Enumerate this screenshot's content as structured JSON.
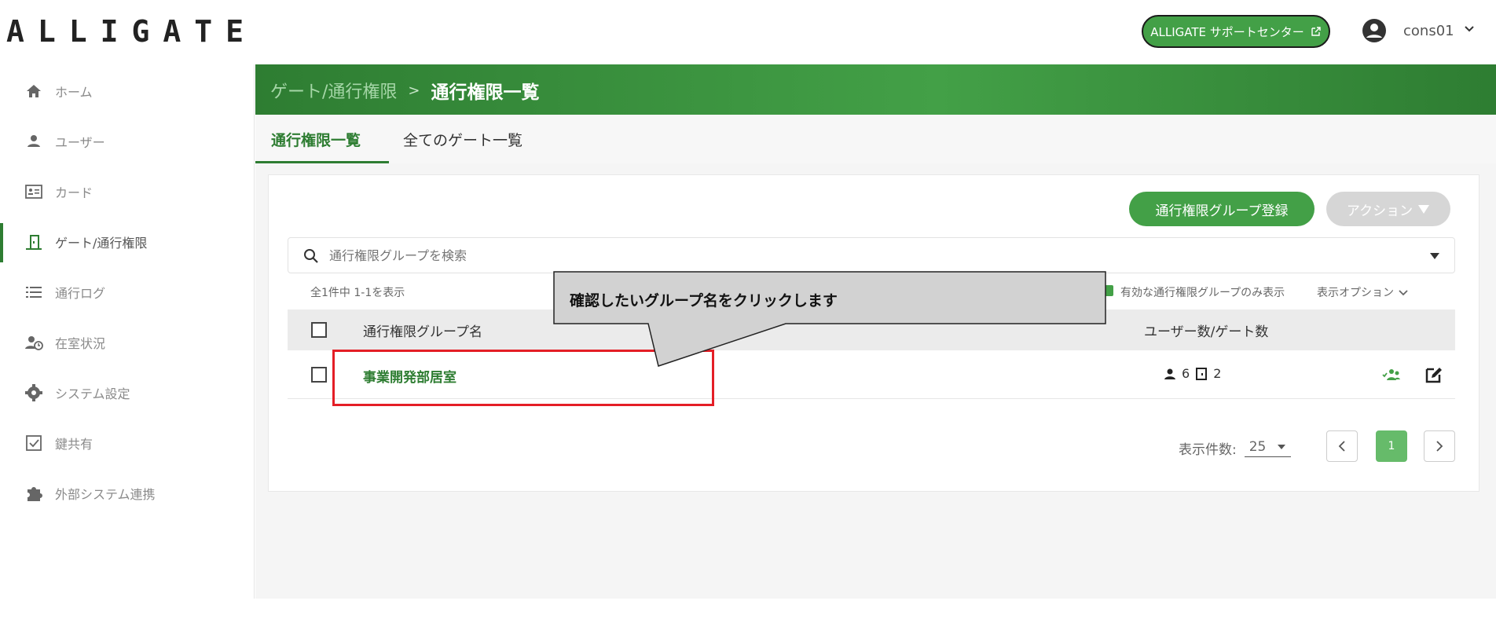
{
  "header": {
    "logo": "ALLIGATE",
    "support_button": "ALLIGATE サポートセンター",
    "user_name": "cons01"
  },
  "sidebar": {
    "items": [
      {
        "label": "ホーム",
        "icon": "home-icon"
      },
      {
        "label": "ユーザー",
        "icon": "user-icon"
      },
      {
        "label": "カード",
        "icon": "card-icon"
      },
      {
        "label": "ゲート/通行権限",
        "icon": "gate-icon",
        "active": true
      },
      {
        "label": "通行ログ",
        "icon": "list-icon"
      },
      {
        "label": "在室状況",
        "icon": "presence-icon"
      },
      {
        "label": "システム設定",
        "icon": "gear-icon"
      },
      {
        "label": "鍵共有",
        "icon": "checkbox-icon"
      },
      {
        "label": "外部システム連携",
        "icon": "puzzle-icon"
      }
    ]
  },
  "breadcrumb": {
    "parent": "ゲート/通行権限",
    "separator": ">",
    "current": "通行権限一覧"
  },
  "tabs": [
    {
      "label": "通行権限一覧"
    },
    {
      "label": "全てのゲート一覧"
    }
  ],
  "toolbar": {
    "register_button": "通行権限グループ登録",
    "action_button": "アクション"
  },
  "search": {
    "placeholder": "通行権限グループを検索"
  },
  "list_meta": {
    "count_text": "全1件中 1-1を表示",
    "filter_label": "有効な通行権限グループのみ表示",
    "view_options": "表示オプション"
  },
  "table": {
    "columns": [
      "通行権限グループ名",
      "ユーザー数/ゲート数"
    ],
    "rows": [
      {
        "name": "事業開発部居室",
        "users": "6",
        "gates": "2"
      }
    ]
  },
  "pagination": {
    "page_size_label": "表示件数:",
    "page_size": "25",
    "current_page": "1"
  },
  "annotation": {
    "callout_text": "確認したいグループ名をクリックします",
    "highlight_color": "#e41e26"
  },
  "colors": {
    "primary": "#43a047",
    "dark_green": "#2e7d32"
  }
}
